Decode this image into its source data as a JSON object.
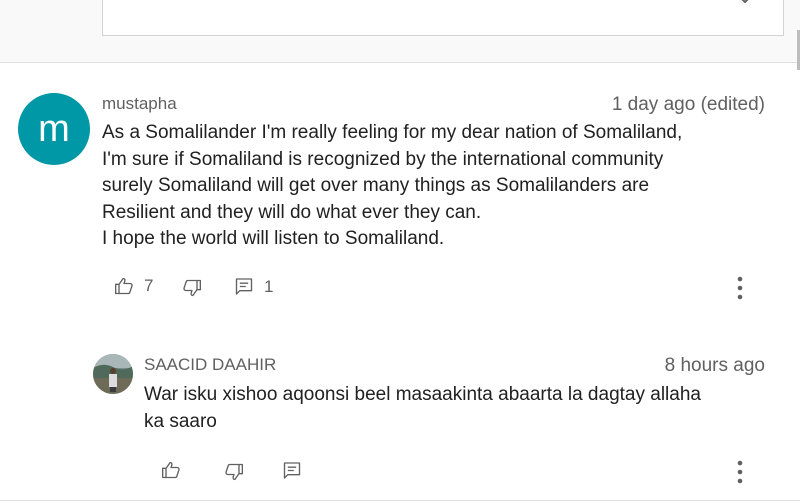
{
  "comments": [
    {
      "author": "mustapha",
      "avatar_letter": "m",
      "avatar_color": "#0097a7",
      "timestamp": "1 day ago (edited)",
      "text": "As a Somalilander I'm really feeling for my dear nation of Somaliland,\nI'm sure if Somaliland is recognized by the international community\nsurely Somaliland will get over many things as Somalilanders are\nResilient and they will do what ever they can.\nI hope the world will listen to Somaliland.",
      "likes": "7",
      "replies": "1"
    }
  ],
  "reply": {
    "author": "SAACID DAAHIR",
    "timestamp": "8 hours ago",
    "text": "War isku xishoo aqoonsi beel masaakinta abaarta la dagtay allaha\nka saaro"
  },
  "icons": {
    "like": "thumbs-up-icon",
    "dislike": "thumbs-down-icon",
    "reply": "reply-icon",
    "more": "more-vert-icon",
    "close": "close-icon"
  }
}
